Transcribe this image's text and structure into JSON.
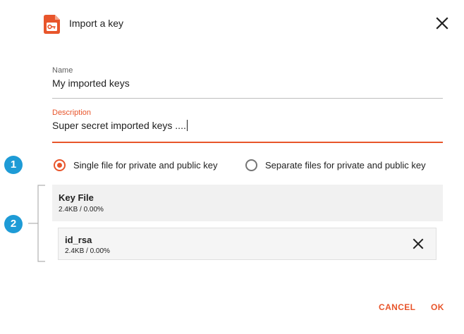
{
  "dialog": {
    "title": "Import a key",
    "accent_color": "#e8552b"
  },
  "fields": {
    "name": {
      "label": "Name",
      "value": "My imported keys"
    },
    "description": {
      "label": "Description",
      "value": "Super secret imported keys ...."
    }
  },
  "badges": {
    "step1": "1",
    "step2": "2",
    "color": "#1e9bd6"
  },
  "radio": {
    "options": [
      {
        "label": "Single file for private and public key",
        "selected": true
      },
      {
        "label": "Separate files for private and public key",
        "selected": false
      }
    ]
  },
  "files": {
    "group": {
      "title": "Key File",
      "meta": "2.4KB / 0.00%"
    },
    "items": [
      {
        "name": "id_rsa",
        "meta": "2.4KB / 0.00%"
      }
    ]
  },
  "footer": {
    "cancel_label": "CANCEL",
    "ok_label": "OK"
  },
  "icons": {
    "app": "key-file-icon",
    "close": "close-icon",
    "remove": "remove-file-icon"
  }
}
